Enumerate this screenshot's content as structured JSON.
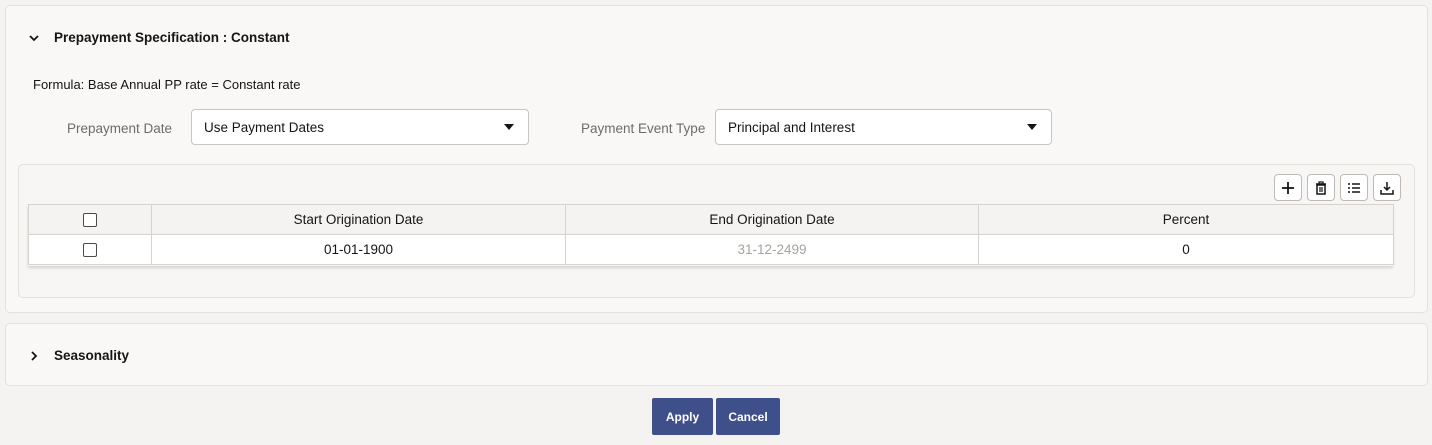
{
  "prepayment": {
    "title": "Prepayment Specification : Constant",
    "formula": "Formula: Base Annual PP rate = Constant rate",
    "prepayment_date": {
      "label": "Prepayment Date",
      "value": "Use Payment Dates"
    },
    "payment_event_type": {
      "label": "Payment Event Type",
      "value": "Principal and Interest"
    },
    "toolbar": [
      "add-icon",
      "delete-icon",
      "list-icon",
      "download-icon"
    ],
    "table": {
      "columns": [
        "Start Origination Date",
        "End Origination Date",
        "Percent"
      ],
      "rows": [
        {
          "start": "01-01-1900",
          "end": "31-12-2499",
          "percent": "0"
        }
      ]
    }
  },
  "seasonality": {
    "title": "Seasonality"
  },
  "footer": {
    "apply": "Apply",
    "cancel": "Cancel"
  },
  "colors": {
    "primary_button": "#3f4f8a",
    "background": "#f5f3f1",
    "muted_text": "#a8a39d"
  }
}
